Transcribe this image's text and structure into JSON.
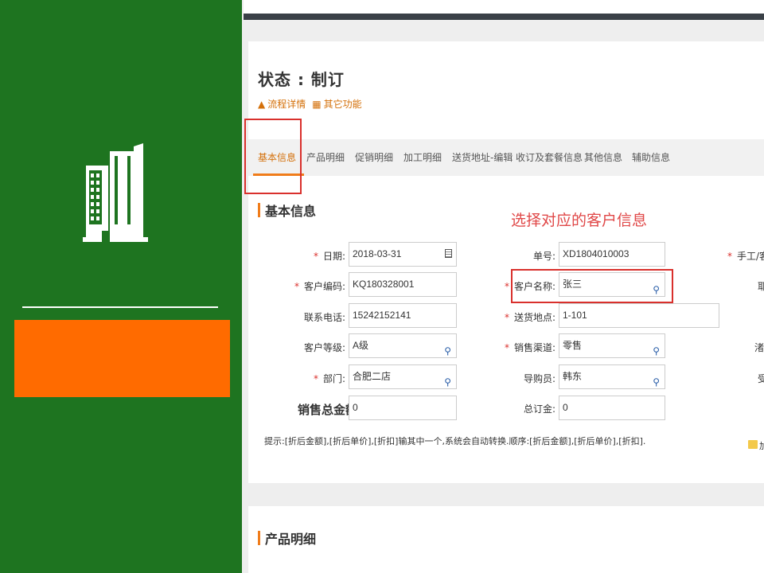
{
  "decor": {
    "icon": "building-icon",
    "colors": {
      "panel": "#1e7420",
      "accent": "#ff6b00"
    }
  },
  "header": {
    "status": "状态 : 制订",
    "links": [
      {
        "icon": "flow-icon",
        "label": "流程详情"
      },
      {
        "icon": "grid-icon",
        "label": "其它功能"
      }
    ]
  },
  "tabs": [
    "基本信息",
    "产品明细",
    "促销明细",
    "加工明细",
    "送货地址-编辑",
    "收订及套餐信息",
    "其他信息",
    "辅助信息"
  ],
  "active_tab": "基本信息",
  "annotation": "选择对应的客户信息",
  "basic_section": {
    "title": "基本信息",
    "fields": {
      "date": {
        "label": "日期:",
        "value": "2018-03-31"
      },
      "order_no": {
        "label": "单号:",
        "value": "XD1804010003"
      },
      "manual": {
        "label": "手工/客户"
      },
      "customer_code": {
        "label": "客户编码:",
        "value": "KQ180328001"
      },
      "customer_name": {
        "label": "客户名称:",
        "value": "张三"
      },
      "phone": {
        "label": "联系电话:",
        "value": "15242152141"
      },
      "delivery_place": {
        "label": "送货地点:",
        "value": "1-101"
      },
      "customer_level": {
        "label": "客户等级:",
        "value": "A级"
      },
      "sales_channel": {
        "label": "销售渠道:",
        "value": "零售"
      },
      "department": {
        "label": "部门:",
        "value": "合肥二店"
      },
      "guide": {
        "label": "导购员:",
        "value": "韩东"
      },
      "total_sales": {
        "label": "销售总金额:",
        "value": "0"
      },
      "total_deposit": {
        "label": "总订金:",
        "value": "0"
      }
    },
    "right_edge": {
      "r1": "耶",
      "r3": "渚",
      "r4": "受"
    },
    "hint": "提示:[折后金额],[折后单价],[折扣]输其中一个,系统会自动转换.顺序:[折后金额],[折后单价],[折扣].",
    "attach_label": "加"
  },
  "product_section": {
    "title": "产品明细"
  }
}
